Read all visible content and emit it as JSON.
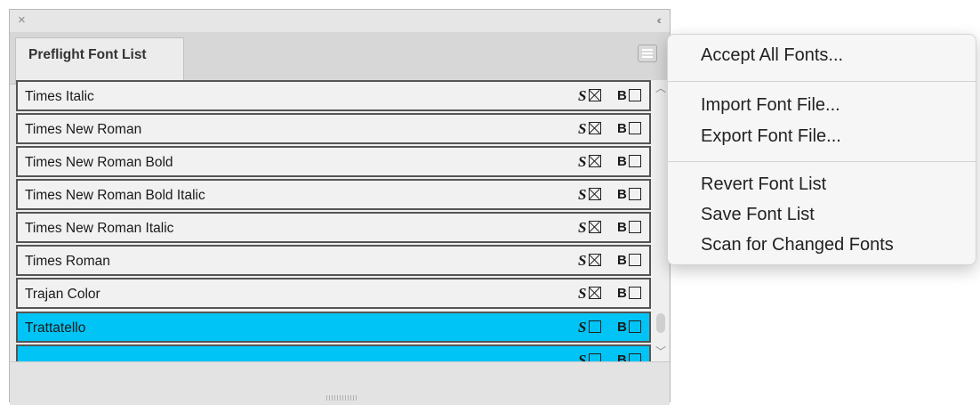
{
  "panel": {
    "close_icon": "×",
    "collapse_icon": "‹‹",
    "tab_label": "Preflight Font List"
  },
  "fonts": [
    {
      "name": "Times Italic",
      "s_label": "S",
      "s_checked": true,
      "b_label": "B",
      "b_checked": false,
      "selected": false
    },
    {
      "name": "Times New Roman",
      "s_label": "S",
      "s_checked": true,
      "b_label": "B",
      "b_checked": false,
      "selected": false
    },
    {
      "name": "Times New Roman Bold",
      "s_label": "S",
      "s_checked": true,
      "b_label": "B",
      "b_checked": false,
      "selected": false
    },
    {
      "name": "Times New Roman Bold Italic",
      "s_label": "S",
      "s_checked": true,
      "b_label": "B",
      "b_checked": false,
      "selected": false
    },
    {
      "name": "Times New Roman Italic",
      "s_label": "S",
      "s_checked": true,
      "b_label": "B",
      "b_checked": false,
      "selected": false
    },
    {
      "name": "Times Roman",
      "s_label": "S",
      "s_checked": true,
      "b_label": "B",
      "b_checked": false,
      "selected": false
    },
    {
      "name": "Trajan Color",
      "s_label": "S",
      "s_checked": true,
      "b_label": "B",
      "b_checked": false,
      "selected": false
    },
    {
      "name": "Trattatello",
      "s_label": "S",
      "s_checked": false,
      "b_label": "B",
      "b_checked": false,
      "selected": true
    },
    {
      "name": "",
      "s_label": "S",
      "s_checked": false,
      "b_label": "B",
      "b_checked": false,
      "selected": true
    }
  ],
  "menu": {
    "accept_all": "Accept All Fonts...",
    "import_file": "Import Font File...",
    "export_file": "Export Font File...",
    "revert_list": "Revert Font List",
    "save_list": "Save Font List",
    "scan_changed": "Scan for Changed Fonts"
  },
  "colors": {
    "selection": "#00c4f5",
    "panel_bg": "#e6e6e6"
  }
}
